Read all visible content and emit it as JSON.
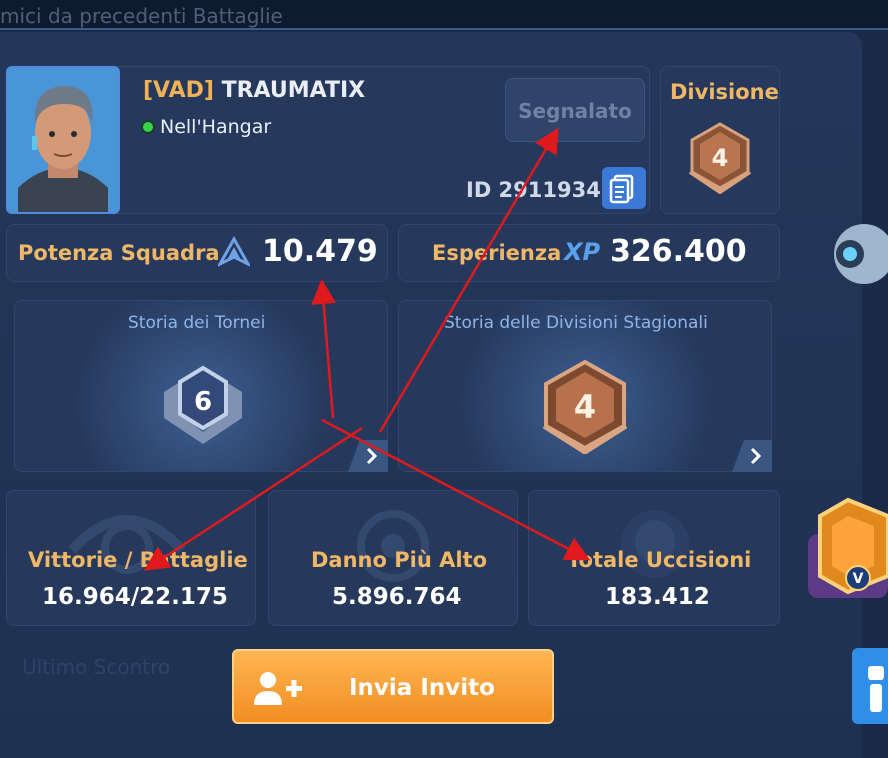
{
  "header": {
    "background_title": "mici da precedenti Battaglie"
  },
  "player": {
    "clan_tag": "[VAD]",
    "name": "TRAUMATIX",
    "status": "Nell'Hangar",
    "report_button": "Segnalato",
    "id_label": "ID 2911934"
  },
  "division": {
    "label": "Divisione",
    "rank": "4"
  },
  "stats": {
    "power_label": "Potenza Squadra",
    "power_value": "10.479",
    "xp_label": "Esperienza",
    "xp_icon_text": "XP",
    "xp_value": "326.400"
  },
  "history": {
    "tournaments_title": "Storia dei Tornei",
    "tournaments_badge": "6",
    "seasonal_title": "Storia delle Divisioni Stagionali",
    "seasonal_badge": "4"
  },
  "battle_stats": [
    {
      "label": "Vittorie / Battaglie",
      "value": "16.964/22.175"
    },
    {
      "label": "Danno Più Alto",
      "value": "5.896.764"
    },
    {
      "label": "Totale Uccisioni",
      "value": "183.412"
    }
  ],
  "invite_button": "Invia Invito",
  "side_badge": {
    "letter": "V"
  },
  "colors": {
    "accent_orange": "#f28d22",
    "label_gold": "#f0b766",
    "label_blue": "#8fb4e8",
    "status_green": "#38d24a",
    "annotation_red": "#e0191d"
  }
}
